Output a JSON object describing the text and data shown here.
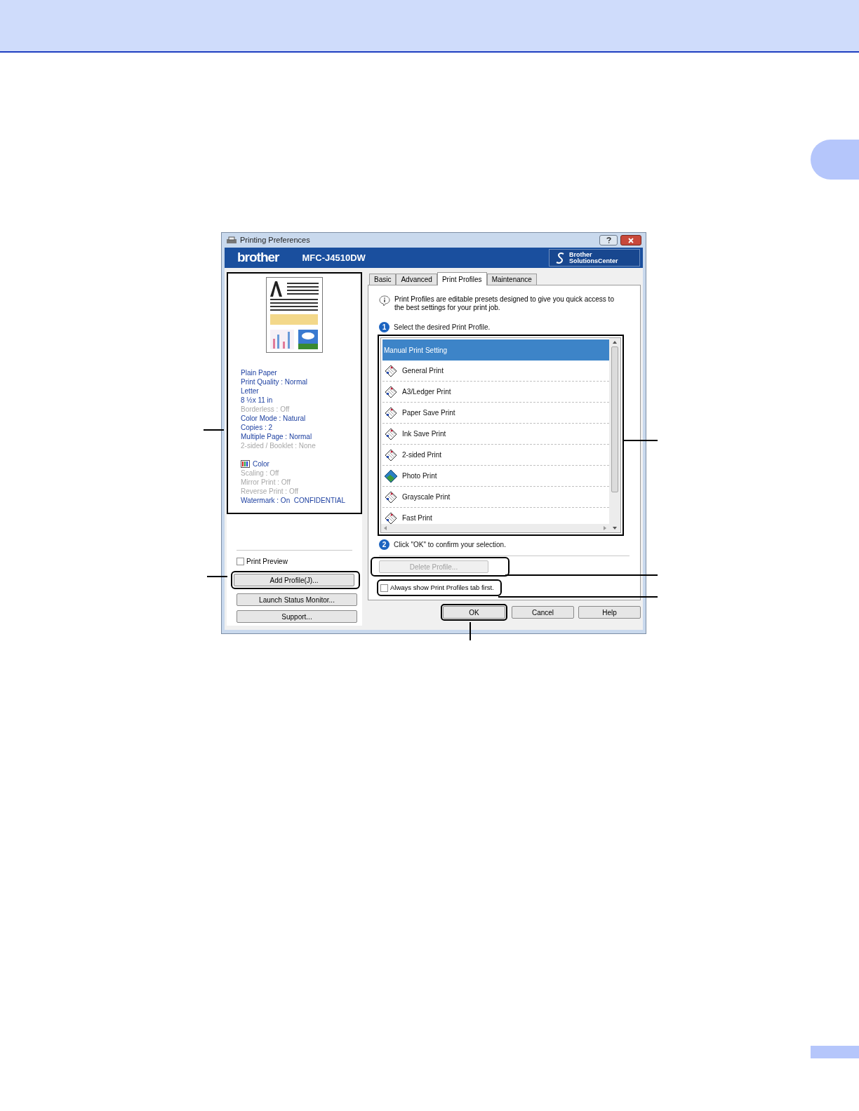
{
  "window": {
    "title": "Printing Preferences"
  },
  "brand": {
    "logo": "brother",
    "model": "MFC-J4510DW",
    "solutions": [
      "Brother",
      "SolutionsCenter"
    ]
  },
  "summary": [
    {
      "text": "Plain Paper",
      "disabled": false
    },
    {
      "text": "Print Quality : Normal",
      "disabled": false
    },
    {
      "text": "Letter",
      "disabled": false
    },
    {
      "text": "8 ½x 11 in",
      "disabled": false
    },
    {
      "text": "Borderless : Off",
      "disabled": true
    },
    {
      "text": "Color Mode : Natural",
      "disabled": false
    },
    {
      "text": "Copies : 2",
      "disabled": false
    },
    {
      "text": "Multiple Page : Normal",
      "disabled": false
    },
    {
      "text": "2-sided / Booklet : None",
      "disabled": true
    }
  ],
  "summary_extra": [
    {
      "text": "Color",
      "disabled": false,
      "kind": "color"
    },
    {
      "text": "Scaling : Off",
      "disabled": true,
      "kind": "plain"
    },
    {
      "text": "Mirror Print : Off",
      "disabled": true,
      "kind": "plain"
    },
    {
      "text": "Reverse Print : Off",
      "disabled": true,
      "kind": "plain"
    },
    {
      "text": "Watermark : On  CONFIDENTIAL",
      "disabled": false,
      "kind": "plain"
    }
  ],
  "print_preview": {
    "label": "Print Preview",
    "checked": false
  },
  "left_buttons": [
    "Add Profile(J)...",
    "Launch Status Monitor...",
    "Support..."
  ],
  "tabs": [
    {
      "label": "Basic",
      "selected": false
    },
    {
      "label": "Advanced",
      "selected": false
    },
    {
      "label": "Print Profiles",
      "selected": true
    },
    {
      "label": "Maintenance",
      "selected": false
    }
  ],
  "info": "Print Profiles are editable presets designed to give you quick access to the best settings for your print job.",
  "step1": {
    "number": "1",
    "text": "Select the desired Print Profile."
  },
  "profiles": [
    {
      "label": "Manual Print Setting",
      "selected": true,
      "kind": "none"
    },
    {
      "label": "General Print",
      "selected": false,
      "kind": "document"
    },
    {
      "label": "A3/Ledger Print",
      "selected": false,
      "kind": "document"
    },
    {
      "label": "Paper Save Print",
      "selected": false,
      "kind": "document"
    },
    {
      "label": "Ink Save Print",
      "selected": false,
      "kind": "document"
    },
    {
      "label": "2-sided Print",
      "selected": false,
      "kind": "document"
    },
    {
      "label": "Photo Print",
      "selected": false,
      "kind": "photo"
    },
    {
      "label": "Grayscale Print",
      "selected": false,
      "kind": "document"
    },
    {
      "label": "Fast Print",
      "selected": false,
      "kind": "document"
    }
  ],
  "step2": {
    "number": "2",
    "text": "Click \"OK\" to confirm your selection."
  },
  "delete_button": {
    "label": "Delete Profile...",
    "disabled": true
  },
  "always_show": {
    "label": "Always show Print Profiles tab first.",
    "checked": false
  },
  "dialog_buttons": [
    "OK",
    "Cancel",
    "Help"
  ]
}
